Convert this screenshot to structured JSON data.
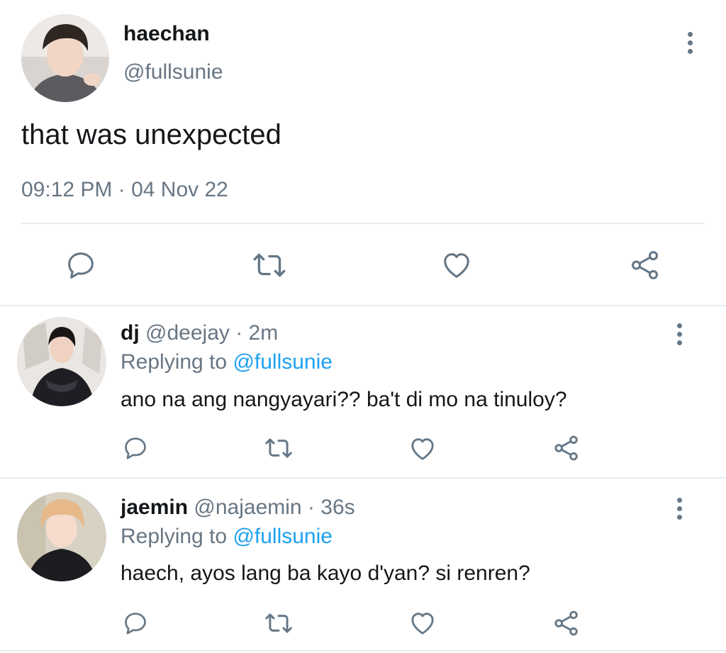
{
  "main_tweet": {
    "display_name": "haechan",
    "handle": "@fullsunie",
    "text": "that was unexpected",
    "timestamp": "09:12 PM · 04 Nov 22",
    "actions": [
      "reply-icon",
      "retweet-icon",
      "like-icon",
      "share-icon"
    ]
  },
  "replies": [
    {
      "display_name": "dj",
      "handle": "@deejay",
      "time": "· 2m",
      "replying_prefix": "Replying to",
      "replying_handle": "@fullsunie",
      "text": "ano na ang nangyayari?? ba't di mo na tinuloy?"
    },
    {
      "display_name": "jaemin",
      "handle": "@najaemin",
      "time": "· 36s",
      "replying_prefix": "Replying to",
      "replying_handle": "@fullsunie",
      "text": "haech, ayos lang ba kayo d'yan? si renren?"
    }
  ],
  "colors": {
    "text": "#14171a",
    "muted": "#687684",
    "link": "#1da1f2",
    "icon": "#657786",
    "divider": "#e6ecf0"
  }
}
